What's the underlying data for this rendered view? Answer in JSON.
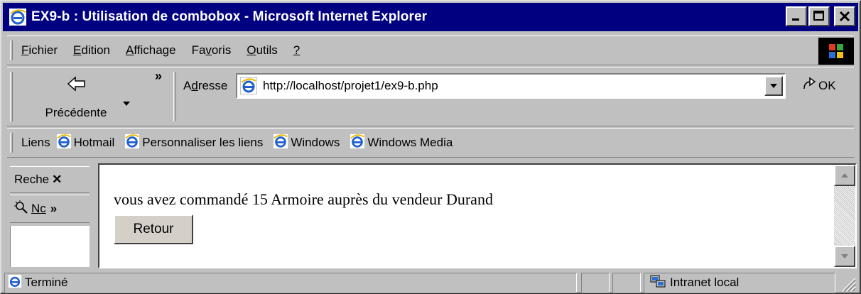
{
  "window": {
    "title": "EX9-b : Utilisation de combobox - Microsoft Internet Explorer",
    "icon": "ie-icon",
    "controls": [
      "minimize-icon",
      "maximize-icon",
      "close-icon"
    ]
  },
  "menu": {
    "items": [
      {
        "accel": "F",
        "rest": "ichier"
      },
      {
        "accel": "E",
        "rest": "dition"
      },
      {
        "accel": "A",
        "rest": "ffichage"
      },
      {
        "pre": "Fa",
        "accel": "v",
        "rest": "oris"
      },
      {
        "accel": "O",
        "rest": "utils"
      },
      {
        "accel": "?",
        "rest": ""
      }
    ]
  },
  "toolbar": {
    "back_label": "Précédente",
    "more_glyph": "»"
  },
  "address": {
    "label_pre": "A",
    "label_accel": "d",
    "label_rest": "resse",
    "url": "http://localhost/projet1/ex9-b.php",
    "go_label": "OK"
  },
  "links": {
    "label": "Liens",
    "items": [
      "Hotmail",
      "Personnaliser les liens",
      "Windows",
      "Windows Media"
    ]
  },
  "explorer_bar": {
    "search_label": "Reche",
    "close_glyph": "✕",
    "tab2_label": "Nc",
    "more_glyph": "»"
  },
  "content": {
    "message": "vous avez commandé 15 Armoire auprès du vendeur Durand",
    "return_button": "Retour"
  },
  "status": {
    "text": "Terminé",
    "zone": "Intranet local"
  },
  "colors": {
    "titlebar": "#000080",
    "chrome": "#c0c0c0",
    "content_bg": "#ffffff"
  }
}
